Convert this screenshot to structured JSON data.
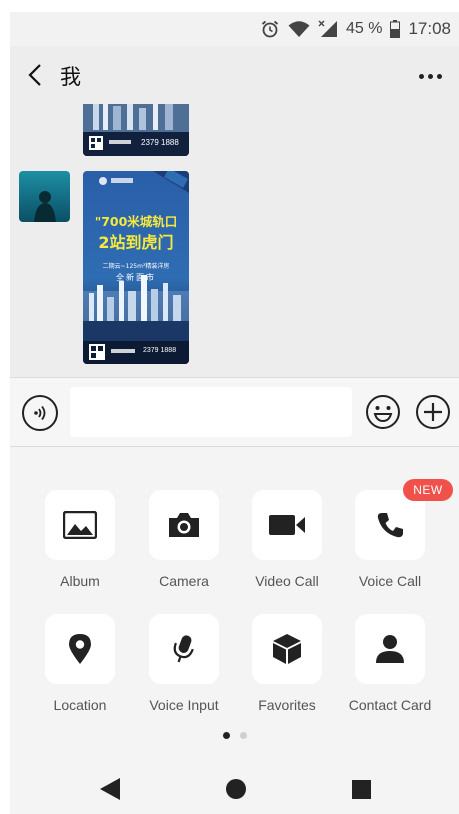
{
  "status_bar": {
    "icons": [
      "alarm-icon",
      "wifi-icon",
      "signal-icon",
      "battery-icon"
    ],
    "battery": "45 %",
    "time": "17:08"
  },
  "header": {
    "back_icon": "chevron-left-icon",
    "title": "我",
    "more_icon": "more-dots-icon"
  },
  "messages": [
    {
      "type": "image",
      "sender": "other",
      "poster_phone": "2379 1888"
    },
    {
      "type": "image",
      "sender": "other",
      "poster_line1": "\"700米城轨口",
      "poster_line2": "2站到虎门",
      "poster_tag": "二期云~125m²精装洋房",
      "poster_tag2": "全新面市",
      "poster_phone": "2379 1888"
    }
  ],
  "input_bar": {
    "voice_icon": "voice-toggle-icon",
    "message_value": "",
    "emoji_icon": "emoji-icon",
    "plus_icon": "plus-icon"
  },
  "tools": [
    {
      "label": "Album",
      "icon": "album-icon"
    },
    {
      "label": "Camera",
      "icon": "camera-icon"
    },
    {
      "label": "Video Call",
      "icon": "video-call-icon"
    },
    {
      "label": "Voice Call",
      "icon": "voice-call-icon",
      "badge": "NEW"
    },
    {
      "label": "Location",
      "icon": "location-icon"
    },
    {
      "label": "Voice Input",
      "icon": "voice-input-icon"
    },
    {
      "label": "Favorites",
      "icon": "favorites-icon"
    },
    {
      "label": "Contact Card",
      "icon": "contact-card-icon"
    }
  ],
  "pager": {
    "current_page": 1,
    "total_pages": 2
  },
  "colors": {
    "badge": "#f0524b",
    "panel": "#f4f4f4",
    "chat_bg": "#ededed"
  }
}
